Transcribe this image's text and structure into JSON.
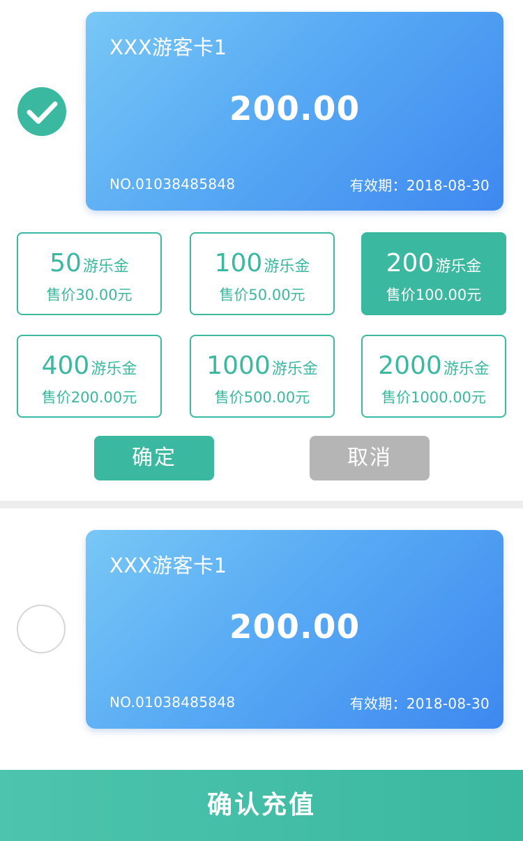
{
  "cards": [
    {
      "name": "XXX游客卡1",
      "amount": "200.00",
      "number": "NO.01038485848",
      "expiry": "有效期：2018-08-30",
      "selected": true
    },
    {
      "name": "XXX游客卡1",
      "amount": "200.00",
      "number": "NO.01038485848",
      "expiry": "有效期：2018-08-30",
      "selected": false
    }
  ],
  "options": [
    {
      "amount": "50",
      "unit": "游乐金",
      "price": "售价30.00元",
      "selected": false
    },
    {
      "amount": "100",
      "unit": "游乐金",
      "price": "售价50.00元",
      "selected": false
    },
    {
      "amount": "200",
      "unit": "游乐金",
      "price": "售价100.00元",
      "selected": true
    },
    {
      "amount": "400",
      "unit": "游乐金",
      "price": "售价200.00元",
      "selected": false
    },
    {
      "amount": "1000",
      "unit": "游乐金",
      "price": "售价500.00元",
      "selected": false
    },
    {
      "amount": "2000",
      "unit": "游乐金",
      "price": "售价1000.00元",
      "selected": false
    }
  ],
  "buttons": {
    "confirm_label": "确定",
    "cancel_label": "取消"
  },
  "bottom_bar": {
    "label": "确认充值"
  },
  "colors": {
    "accent": "#3bb8a0",
    "card_gradient_start": "#78c7f6",
    "card_gradient_end": "#3d88f0",
    "cancel_gray": "#b5b5b5",
    "divider": "#ededed"
  },
  "icons": {
    "selected_radio": "check-circle-icon",
    "unselected_radio": "empty-circle-icon"
  }
}
